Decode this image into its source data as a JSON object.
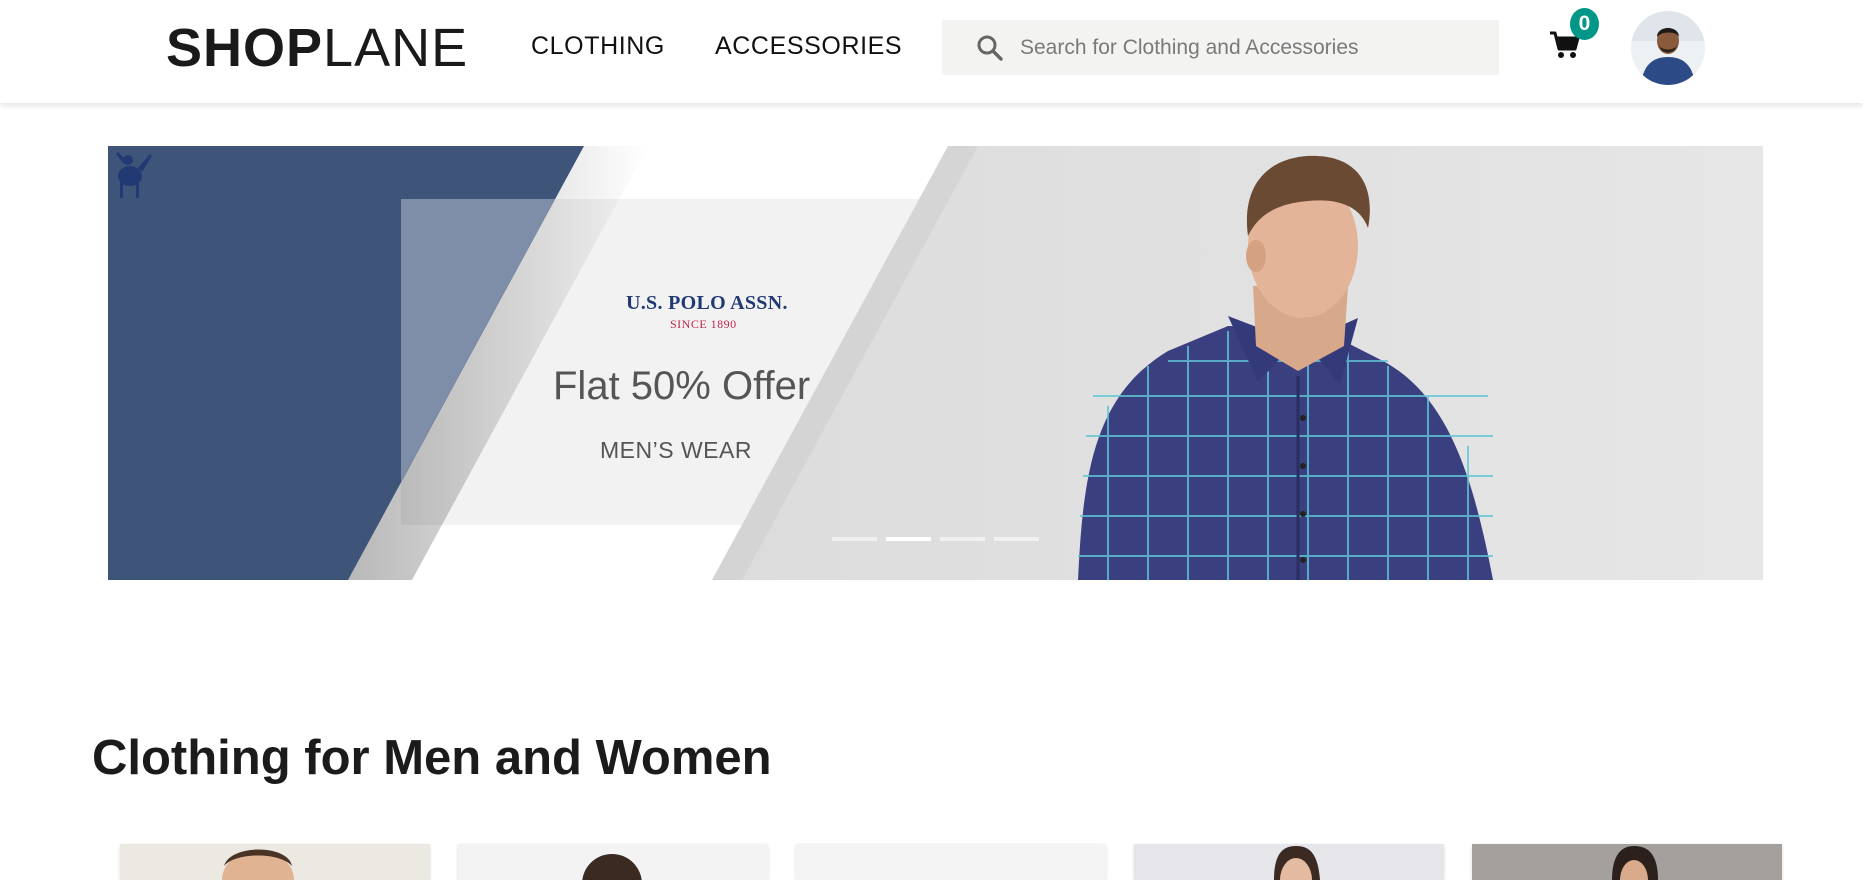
{
  "header": {
    "logo_bold": "SHOP",
    "logo_light": "LANE",
    "nav": [
      {
        "label": "CLOTHING"
      },
      {
        "label": "ACCESSORIES"
      }
    ],
    "search": {
      "placeholder": "Search for Clothing and Accessories",
      "value": "",
      "icon": "search-icon"
    },
    "cart": {
      "icon": "cart-icon",
      "count": "0"
    },
    "avatar": {
      "icon": "user-avatar"
    }
  },
  "banner": {
    "brand_name": "U.S. POLO ASSN.",
    "brand_since": "SINCE 1890",
    "offer": "Flat 50% Offer",
    "subline": "MEN’S WEAR",
    "slides_total": 4,
    "active_slide": 2,
    "colors": {
      "navy": "#3f5479",
      "shirt": "#3a3f7f"
    }
  },
  "section": {
    "title": "Clothing for Men and Women"
  },
  "colors": {
    "badge": "#009688",
    "search_bg": "#f3f3f2"
  }
}
